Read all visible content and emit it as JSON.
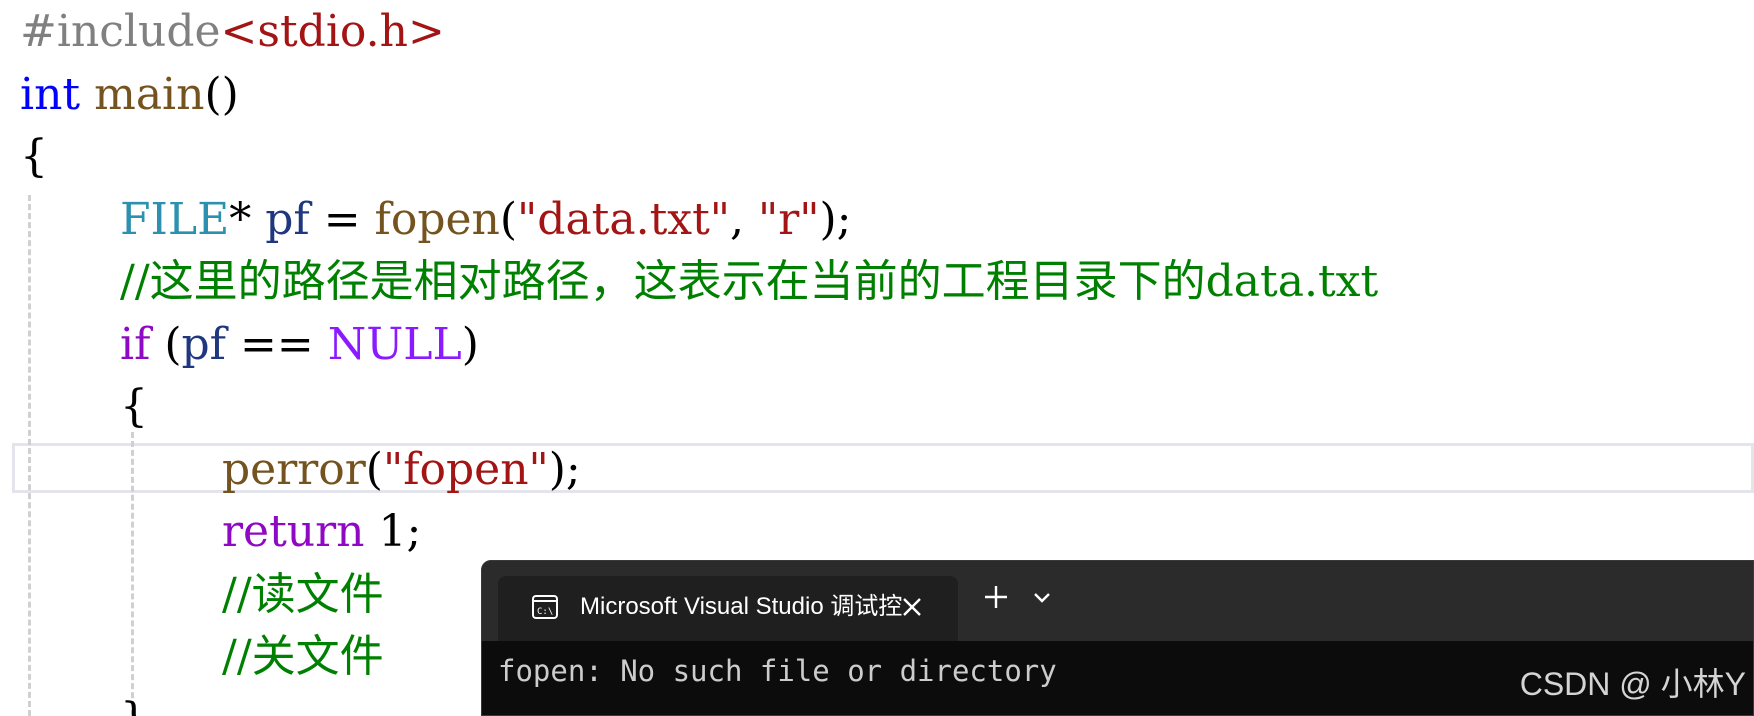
{
  "editor": {
    "lines": [
      {
        "tokens": [
          {
            "text": "#include",
            "cls": "c-pp"
          },
          {
            "text": "<stdio.h>",
            "cls": "c-inc"
          }
        ]
      },
      {
        "tokens": [
          {
            "text": "int",
            "cls": "c-kw"
          },
          {
            "text": " ",
            "cls": ""
          },
          {
            "text": "main",
            "cls": "c-fn"
          },
          {
            "text": "()",
            "cls": ""
          }
        ]
      },
      {
        "tokens": [
          {
            "text": "{",
            "cls": ""
          }
        ]
      },
      {
        "tokens": [
          {
            "text": "FILE",
            "cls": "c-type"
          },
          {
            "text": "* ",
            "cls": ""
          },
          {
            "text": "pf",
            "cls": "c-var"
          },
          {
            "text": " = ",
            "cls": ""
          },
          {
            "text": "fopen",
            "cls": "c-fn"
          },
          {
            "text": "(",
            "cls": ""
          },
          {
            "text": "\"data.txt\"",
            "cls": "c-str"
          },
          {
            "text": ", ",
            "cls": ""
          },
          {
            "text": "\"r\"",
            "cls": "c-str"
          },
          {
            "text": ");",
            "cls": ""
          }
        ]
      },
      {
        "tokens": [
          {
            "text": "//这里的路径是相对路径，这表示在当前的工程目录下的data.txt",
            "cls": "c-cmt"
          }
        ]
      },
      {
        "tokens": [
          {
            "text": "if",
            "cls": "c-ctl"
          },
          {
            "text": " (",
            "cls": ""
          },
          {
            "text": "pf",
            "cls": "c-var"
          },
          {
            "text": " == ",
            "cls": ""
          },
          {
            "text": "NULL",
            "cls": "c-macro"
          },
          {
            "text": ")",
            "cls": ""
          }
        ]
      },
      {
        "tokens": [
          {
            "text": "{",
            "cls": ""
          }
        ]
      },
      {
        "tokens": [
          {
            "text": "perror",
            "cls": "c-fn"
          },
          {
            "text": "(",
            "cls": ""
          },
          {
            "text": "\"fopen\"",
            "cls": "c-str"
          },
          {
            "text": ");",
            "cls": ""
          }
        ]
      },
      {
        "tokens": [
          {
            "text": "return",
            "cls": "c-ctl"
          },
          {
            "text": " 1;",
            "cls": ""
          }
        ]
      },
      {
        "tokens": [
          {
            "text": "//读文件",
            "cls": "c-cmt"
          }
        ]
      },
      {
        "tokens": [
          {
            "text": "//关文件",
            "cls": "c-cmt"
          }
        ]
      },
      {
        "tokens": [
          {
            "text": "}",
            "cls": ""
          }
        ]
      }
    ]
  },
  "terminal": {
    "tab_title": "Microsoft Visual Studio 调试控",
    "tab_icon": "console-icon",
    "close_icon": "close-icon",
    "new_tab_icon": "plus-icon",
    "dropdown_icon": "chevron-down-icon",
    "output": "fopen: No such file or directory"
  },
  "watermark": "CSDN @ 小林Y",
  "colors": {
    "preprocessor": "#808080",
    "include_path": "#a31515",
    "keyword": "#0000ff",
    "function": "#74531f",
    "type": "#2b91af",
    "variable": "#1f377f",
    "string": "#a31515",
    "comment": "#008000",
    "macro": "#8a1bff",
    "control": "#8f08c4",
    "terminal_bg": "#0c0c0c",
    "terminal_tabbar": "#2b2b2b"
  }
}
